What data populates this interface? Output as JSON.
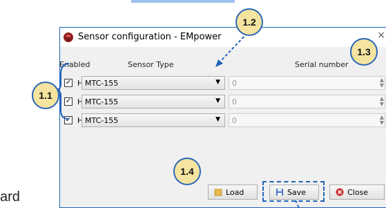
{
  "background": {
    "partial_text": "ard"
  },
  "window": {
    "title": "Sensor configuration - EMpower",
    "close_glyph": "×",
    "headers": {
      "enabled": "Enabled",
      "sensor_type": "Sensor Type",
      "serial_number": "Serial number"
    },
    "rows": [
      {
        "label": "H1",
        "checked": true,
        "sensor_type": "MTC-155",
        "serial": "0"
      },
      {
        "label": "H2",
        "checked": true,
        "sensor_type": "MTC-155",
        "serial": "0"
      },
      {
        "label": "H3",
        "checked": true,
        "sensor_type": "MTC-155",
        "serial": "0"
      }
    ],
    "buttons": {
      "load": "Load",
      "save": "Save",
      "close": "Close"
    }
  },
  "callouts": {
    "c1_1": "1.1",
    "c1_2": "1.2",
    "c1_3": "1.3",
    "c1_4": "1.4"
  },
  "icons": {
    "app": "empower-app-icon",
    "load": "folder-icon",
    "save": "floppy-disk-icon",
    "close": "red-x-circle-icon"
  },
  "colors": {
    "accent": "#1f63b8",
    "callout_fill": "#f4e4a0",
    "callout_border": "#2a66b8"
  }
}
